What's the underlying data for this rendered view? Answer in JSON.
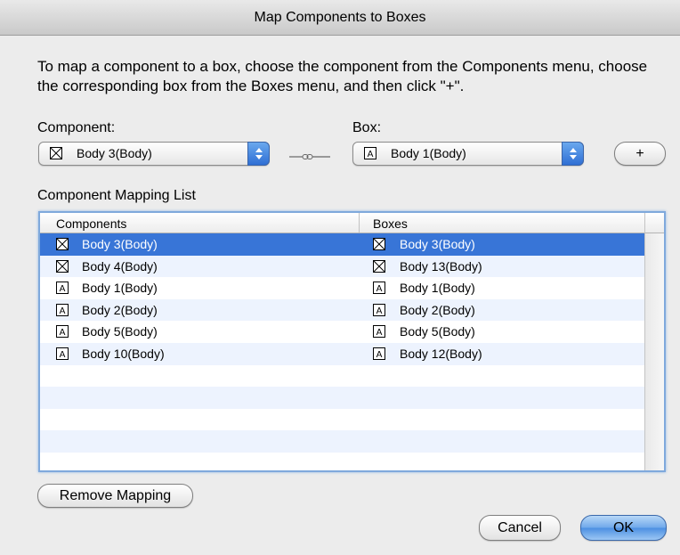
{
  "dialog": {
    "title": "Map Components to Boxes",
    "instructions": "To map a component to a box, choose the component from the Components menu, choose the corresponding box from the Boxes menu, and then click \"+\"."
  },
  "component": {
    "label": "Component:",
    "selected": "Body 3(Body)",
    "icon": "crossed-box-icon"
  },
  "box": {
    "label": "Box:",
    "selected": "Body 1(Body)",
    "icon": "text-box-icon"
  },
  "add_button": "+",
  "mapping_list": {
    "label": "Component Mapping List",
    "columns": [
      "Components",
      "Boxes"
    ],
    "rows": [
      {
        "component": "Body 3(Body)",
        "component_icon": "crossed-box-icon",
        "box": "Body 3(Body)",
        "box_icon": "crossed-box-icon",
        "selected": true
      },
      {
        "component": "Body 4(Body)",
        "component_icon": "crossed-box-icon",
        "box": "Body 13(Body)",
        "box_icon": "crossed-box-icon",
        "selected": false
      },
      {
        "component": "Body 1(Body)",
        "component_icon": "text-box-icon",
        "box": "Body 1(Body)",
        "box_icon": "text-box-icon",
        "selected": false
      },
      {
        "component": "Body 2(Body)",
        "component_icon": "text-box-icon",
        "box": "Body 2(Body)",
        "box_icon": "text-box-icon",
        "selected": false
      },
      {
        "component": "Body 5(Body)",
        "component_icon": "text-box-icon",
        "box": "Body 5(Body)",
        "box_icon": "text-box-icon",
        "selected": false
      },
      {
        "component": "Body 10(Body)",
        "component_icon": "text-box-icon",
        "box": "Body 12(Body)",
        "box_icon": "text-box-icon",
        "selected": false
      }
    ],
    "empty_rows": 5
  },
  "buttons": {
    "remove_mapping": "Remove Mapping",
    "cancel": "Cancel",
    "ok": "OK"
  },
  "colors": {
    "selection": "#3875d7",
    "alternate_row": "#edf3fe",
    "default_button": "#4b8fe2"
  }
}
